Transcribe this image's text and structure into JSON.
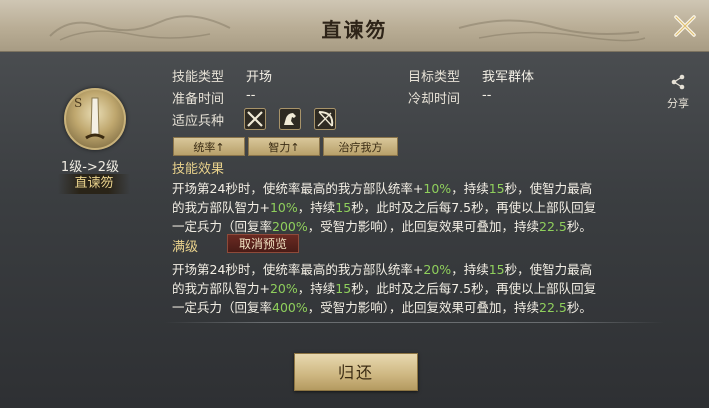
{
  "dialog": {
    "title": "直谏笏",
    "close_icon": "close-icon"
  },
  "skill": {
    "grade": "S",
    "level_change": "1级->2级",
    "name": "直谏笏"
  },
  "info": {
    "skill_type_label": "技能类型",
    "skill_type_value": "开场",
    "target_type_label": "目标类型",
    "target_type_value": "我军群体",
    "prep_time_label": "准备时间",
    "prep_time_value": "--",
    "cooldown_label": "冷却时间",
    "cooldown_value": "--",
    "troop_label": "适应兵种",
    "troop_icons": [
      "spear-icon",
      "cavalry-icon",
      "bow-icon"
    ]
  },
  "share": {
    "label": "分享",
    "icon": "share-icon"
  },
  "tags": [
    "统率↑",
    "智力↑",
    "治疗我方"
  ],
  "effect": {
    "title": "技能效果",
    "lines": [
      [
        {
          "t": "开场第24秒时，使统率最高的我方部队统率+"
        },
        {
          "t": "10%",
          "hl": true
        },
        {
          "t": "，持续"
        },
        {
          "t": "15",
          "hl": true
        },
        {
          "t": "秒，使智力最高"
        }
      ],
      [
        {
          "t": "的我方部队智力+"
        },
        {
          "t": "10%",
          "hl": true
        },
        {
          "t": "，持续"
        },
        {
          "t": "15",
          "hl": true
        },
        {
          "t": "秒，此时及之后每7.5秒，再使以上部队回复"
        }
      ],
      [
        {
          "t": "一定兵力（回复率"
        },
        {
          "t": "200%",
          "hl": true
        },
        {
          "t": "，受智力影响），此回复效果可叠加，持续"
        },
        {
          "t": "22.5",
          "hl": true
        },
        {
          "t": "秒。"
        }
      ]
    ]
  },
  "max": {
    "title": "满级",
    "cancel_preview": "取消预览",
    "lines": [
      [
        {
          "t": "开场第24秒时，使统率最高的我方部队统率+"
        },
        {
          "t": "20%",
          "hl": true
        },
        {
          "t": "，持续"
        },
        {
          "t": "15",
          "hl": true
        },
        {
          "t": "秒，使智力最高"
        }
      ],
      [
        {
          "t": "的我方部队智力+"
        },
        {
          "t": "20%",
          "hl": true
        },
        {
          "t": "，持续"
        },
        {
          "t": "15",
          "hl": true
        },
        {
          "t": "秒，此时及之后每7.5秒，再使以上部队回复"
        }
      ],
      [
        {
          "t": "一定兵力（回复率"
        },
        {
          "t": "400%",
          "hl": true
        },
        {
          "t": "，受智力影响），此回复效果可叠加，持续"
        },
        {
          "t": "22.5",
          "hl": true
        },
        {
          "t": "秒。"
        }
      ]
    ]
  },
  "footer": {
    "return_label": "归还"
  },
  "colors": {
    "highlight": "#8fcf5c",
    "gold_text": "#e9d28c"
  }
}
